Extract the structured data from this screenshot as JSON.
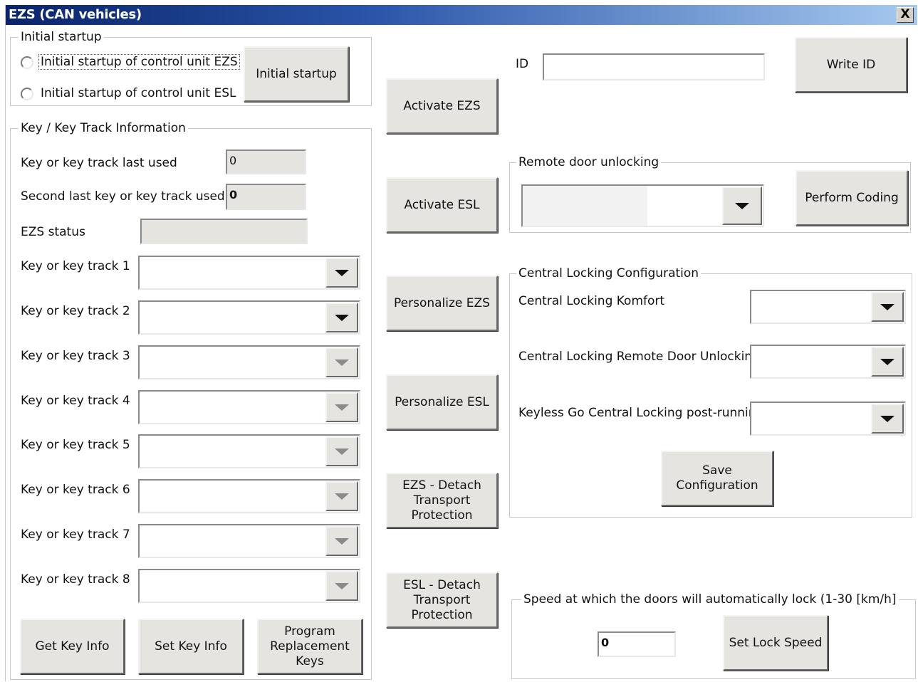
{
  "window": {
    "title": "EZS (CAN vehicles)",
    "close_label": "X"
  },
  "initial_startup": {
    "group_title": "Initial startup",
    "radio_ezs_label": "Initial startup of control unit EZS",
    "radio_esl_label": "Initial startup of control unit ESL",
    "button_label": "Initial startup"
  },
  "key_info": {
    "group_title": "Key / Key Track Information",
    "last_used_label": "Key or key track last used",
    "last_used_value": "0",
    "second_last_label": "Second last key or key track used",
    "second_last_value": "0",
    "ezs_status_label": "EZS status",
    "ezs_status_value": "",
    "tracks": [
      {
        "label": "Key or key track 1",
        "value": ""
      },
      {
        "label": "Key or key track 2",
        "value": ""
      },
      {
        "label": "Key or key track 3",
        "value": ""
      },
      {
        "label": "Key or key track 4",
        "value": ""
      },
      {
        "label": "Key or key track 5",
        "value": ""
      },
      {
        "label": "Key or key track 6",
        "value": ""
      },
      {
        "label": "Key or key track 7",
        "value": ""
      },
      {
        "label": "Key or key track 8",
        "value": ""
      }
    ],
    "get_key_info_label": "Get Key Info",
    "set_key_info_label": "Set Key Info",
    "program_keys_label": "Program Replacement Keys"
  },
  "middle_buttons": {
    "activate_ezs": "Activate EZS",
    "activate_esl": "Activate ESL",
    "personalize_ezs": "Personalize EZS",
    "personalize_esl": "Personalize ESL",
    "ezs_detach": "EZS - Detach Transport Protection",
    "esl_detach": "ESL - Detach Transport Protection"
  },
  "id_section": {
    "label": "ID",
    "value": "",
    "write_id_label": "Write ID"
  },
  "remote_door": {
    "group_title": "Remote door unlocking",
    "value": "",
    "perform_coding_label": "Perform Coding"
  },
  "central_locking": {
    "group_title": "Central Locking Configuration",
    "komfort_label": "Central Locking Komfort",
    "komfort_value": "",
    "remote_label": "Central Locking Remote Door Unlocking",
    "remote_value": "",
    "keyless_label": "Keyless Go Central Locking post-running",
    "keyless_value": "",
    "save_label": "Save Configuration"
  },
  "speed": {
    "group_title": "Speed at which the doors will automatically lock (1-30 [km/h]",
    "value": "0",
    "set_label": "Set Lock Speed"
  }
}
